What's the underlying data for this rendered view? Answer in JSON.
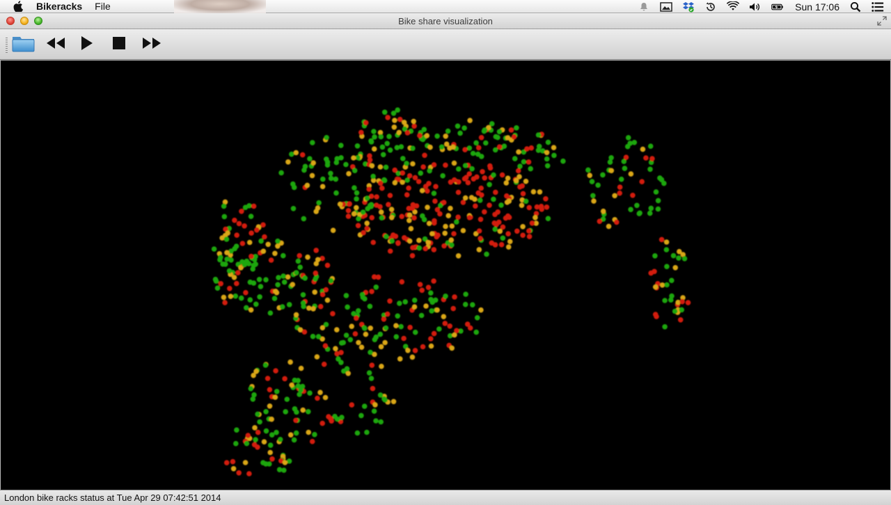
{
  "menubar": {
    "app_name": "Bikeracks",
    "items": [
      "File"
    ],
    "clock": "Sun 17:06"
  },
  "window": {
    "title": "Bike share visualization"
  },
  "toolbar": {
    "buttons": [
      "open-folder",
      "rewind",
      "play",
      "stop",
      "fast-forward"
    ]
  },
  "status": {
    "text": "London bike racks status at Tue Apr 29 07:42:51 2014"
  },
  "colors": {
    "full": "#d21a10",
    "partial": "#d9a612",
    "empty": "#1fa60f",
    "background": "#000000"
  }
}
